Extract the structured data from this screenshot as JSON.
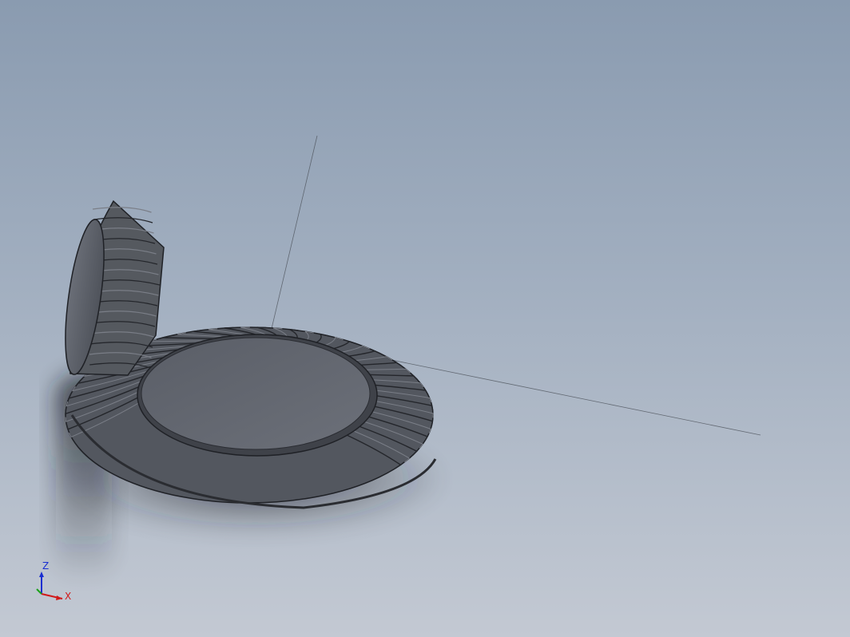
{
  "viewport": {
    "background_top": "#8a9bb0",
    "background_bottom": "#c3c9d3"
  },
  "model": {
    "part_1": "spiral-bevel-gear-large",
    "part_2": "spiral-bevel-pinion",
    "body_color": "#5f636c",
    "edge_color": "#1f2126"
  },
  "triad": {
    "x_label": "X",
    "z_label": "Z",
    "x_color": "#d11a1a",
    "z_color": "#1a2fd1",
    "y_color": "#1aa01a"
  }
}
